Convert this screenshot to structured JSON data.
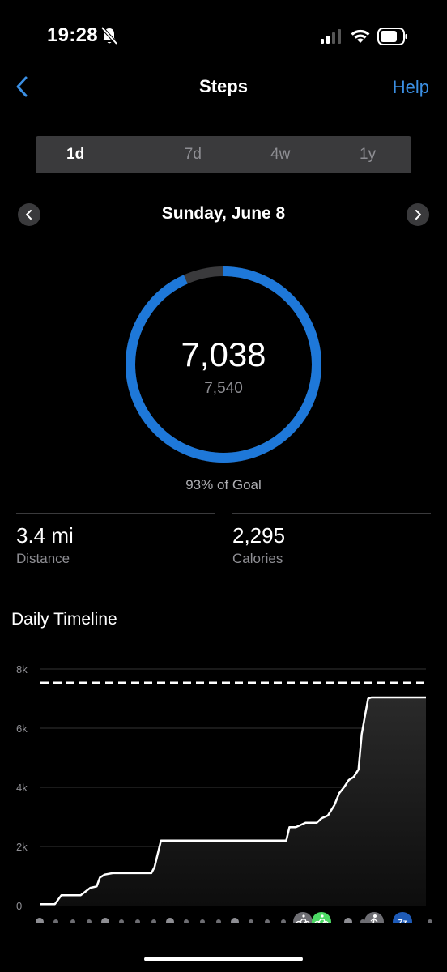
{
  "status": {
    "time": "19:28"
  },
  "nav": {
    "title": "Steps",
    "help": "Help"
  },
  "tabs": [
    {
      "label": "1d",
      "active": true
    },
    {
      "label": "7d",
      "active": false
    },
    {
      "label": "4w",
      "active": false
    },
    {
      "label": "1y",
      "active": false
    }
  ],
  "date": {
    "label": "Sunday, June 8"
  },
  "summary": {
    "steps": "7,038",
    "goal": "7,540",
    "percent_label": "93% of Goal",
    "progress_fraction": 0.933
  },
  "stats": {
    "distance_value": "3.4 mi",
    "distance_label": "Distance",
    "calories_value": "2,295",
    "calories_label": "Calories"
  },
  "timeline": {
    "title": "Daily Timeline"
  },
  "colors": {
    "accent": "#3b8fe3",
    "ring": "#1e78d9",
    "ring_track": "#3a3a3c",
    "cycling_active": "#4cd964",
    "sleep": "#1e5bb8"
  },
  "chart_data": {
    "type": "area",
    "title": "",
    "xlabel": "",
    "ylabel": "",
    "y_ticks": [
      "0",
      "2k",
      "4k",
      "6k",
      "8k"
    ],
    "ylim": [
      0,
      8000
    ],
    "xlim": [
      0,
      24
    ],
    "goal_line": 7540,
    "x": [
      0.0,
      0.9,
      1.3,
      2.5,
      3.1,
      3.5,
      3.7,
      4.0,
      4.5,
      6.9,
      7.1,
      7.5,
      15.3,
      15.5,
      15.9,
      16.5,
      17.2,
      17.5,
      17.9,
      18.3,
      18.6,
      18.9,
      19.2,
      19.5,
      19.8,
      20.0,
      20.2,
      20.4,
      20.6,
      24.0
    ],
    "y": [
      50,
      50,
      350,
      350,
      600,
      650,
      950,
      1050,
      1100,
      1100,
      1300,
      2200,
      2200,
      2650,
      2650,
      2800,
      2800,
      2950,
      3050,
      3400,
      3800,
      4000,
      4250,
      4350,
      4600,
      5800,
      6400,
      7000,
      7040,
      7040
    ],
    "activity_icons": [
      "cycling-icon",
      "cycling-icon",
      "walking-icon",
      "sleep-icon"
    ],
    "grid": true
  }
}
